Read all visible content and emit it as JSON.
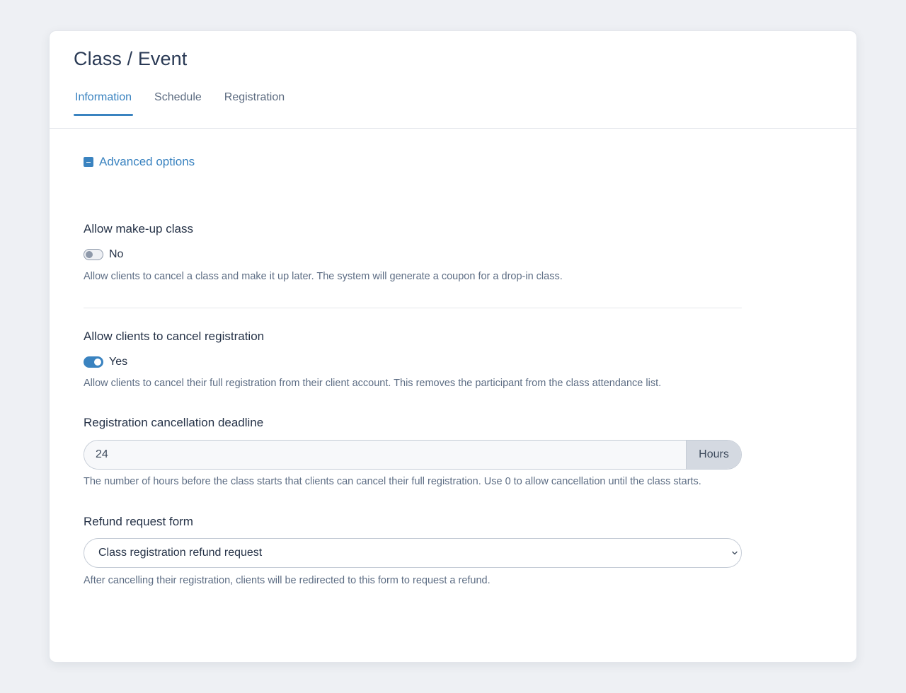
{
  "header": {
    "title": "Class / Event",
    "tabs": [
      {
        "label": "Information",
        "active": true
      },
      {
        "label": "Schedule",
        "active": false
      },
      {
        "label": "Registration",
        "active": false
      }
    ]
  },
  "advanced": {
    "label": "Advanced options",
    "icon": "collapse-minus-icon"
  },
  "makeup": {
    "title": "Allow make-up class",
    "toggle_value": "No",
    "enabled": false,
    "help": "Allow clients to cancel a class and make it up later. The system will generate a coupon for a drop-in class."
  },
  "cancel": {
    "title": "Allow clients to cancel registration",
    "toggle_value": "Yes",
    "enabled": true,
    "help": "Allow clients to cancel their full registration from their client account. This removes the participant from the class attendance list."
  },
  "deadline": {
    "title": "Registration cancellation deadline",
    "value": "24",
    "unit": "Hours",
    "help": "The number of hours before the class starts that clients can cancel their full registration. Use 0 to allow cancellation until the class starts."
  },
  "refund": {
    "title": "Refund request form",
    "selected": "Class registration refund request",
    "help": "After cancelling their registration, clients will be redirected to this form to request a refund."
  },
  "colors": {
    "accent": "#3a83c0",
    "background": "#eef0f4"
  }
}
